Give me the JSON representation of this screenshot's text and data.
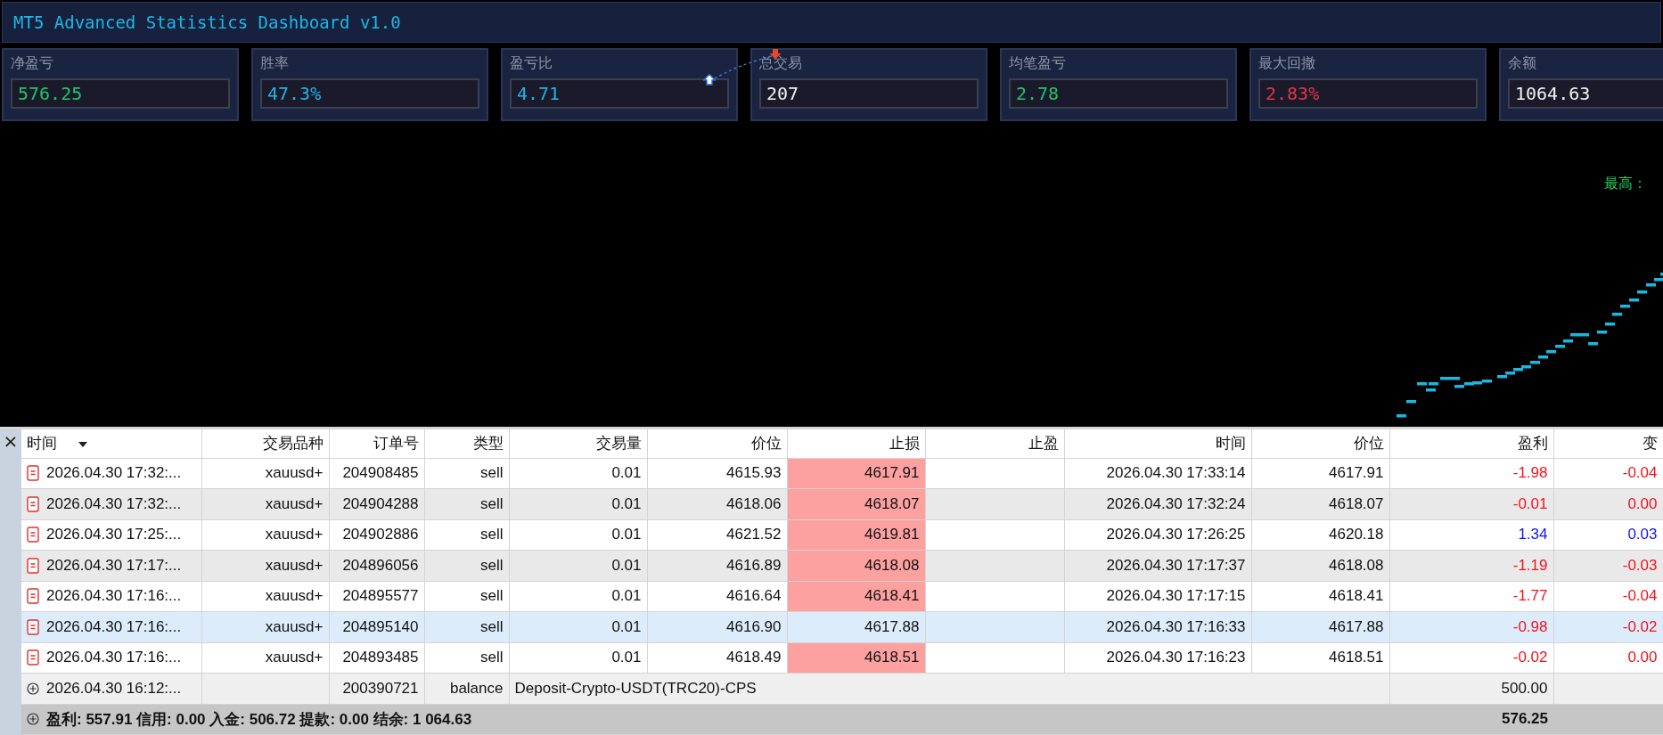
{
  "window": {
    "title": "MT5 Advanced Statistics Dashboard v1.0"
  },
  "cards": [
    {
      "label": "净盈亏",
      "value": "576.25",
      "color": "#1fc46c"
    },
    {
      "label": "胜率",
      "value": "47.3%",
      "color": "#1eb6e6"
    },
    {
      "label": "盈亏比",
      "value": "4.71",
      "color": "#1eb6e6"
    },
    {
      "label": "总交易",
      "value": "207",
      "color": "#f2f2f2"
    },
    {
      "label": "均笔盈亏",
      "value": "2.78",
      "color": "#1fc46c"
    },
    {
      "label": "最大回撤",
      "value": "2.83%",
      "color": "#e0354a"
    },
    {
      "label": "余额",
      "value": "1064.63",
      "color": "#f2f2f2"
    }
  ],
  "chart": {
    "high_label": "最高："
  },
  "side_panel": {
    "close": "×"
  },
  "table": {
    "columns": [
      {
        "label": "时间",
        "sorted": true
      },
      {
        "label": "交易品种",
        "sorted": false
      },
      {
        "label": "订单号",
        "sorted": false
      },
      {
        "label": "类型",
        "sorted": false
      },
      {
        "label": "交易量",
        "sorted": false
      },
      {
        "label": "价位",
        "sorted": false
      },
      {
        "label": "止损",
        "sorted": false
      },
      {
        "label": "止盈",
        "sorted": false
      },
      {
        "label": "时间",
        "sorted": false
      },
      {
        "label": "价位",
        "sorted": false
      },
      {
        "label": "盈利",
        "sorted": false
      },
      {
        "label": "变",
        "sorted": false
      }
    ],
    "rows": [
      {
        "kind": "trade",
        "selected": false,
        "sl_highlight": true,
        "loss": true,
        "cells": [
          "2026.04.30 17:32:...",
          "xauusd+",
          "204908485",
          "sell",
          "0.01",
          "4615.93",
          "4617.91",
          "",
          "2026.04.30 17:33:14",
          "4617.91",
          "-1.98",
          "-0.04"
        ]
      },
      {
        "kind": "trade",
        "selected": false,
        "sl_highlight": true,
        "loss": true,
        "cells": [
          "2026.04.30 17:32:...",
          "xauusd+",
          "204904288",
          "sell",
          "0.01",
          "4618.06",
          "4618.07",
          "",
          "2026.04.30 17:32:24",
          "4618.07",
          "-0.01",
          "0.00"
        ]
      },
      {
        "kind": "trade",
        "selected": false,
        "sl_highlight": true,
        "loss": false,
        "cells": [
          "2026.04.30 17:25:...",
          "xauusd+",
          "204902886",
          "sell",
          "0.01",
          "4621.52",
          "4619.81",
          "",
          "2026.04.30 17:26:25",
          "4620.18",
          "1.34",
          "0.03"
        ]
      },
      {
        "kind": "trade",
        "selected": false,
        "sl_highlight": true,
        "loss": true,
        "cells": [
          "2026.04.30 17:17:...",
          "xauusd+",
          "204896056",
          "sell",
          "0.01",
          "4616.89",
          "4618.08",
          "",
          "2026.04.30 17:17:37",
          "4618.08",
          "-1.19",
          "-0.03"
        ]
      },
      {
        "kind": "trade",
        "selected": false,
        "sl_highlight": true,
        "loss": true,
        "cells": [
          "2026.04.30 17:16:...",
          "xauusd+",
          "204895577",
          "sell",
          "0.01",
          "4616.64",
          "4618.41",
          "",
          "2026.04.30 17:17:15",
          "4618.41",
          "-1.77",
          "-0.04"
        ]
      },
      {
        "kind": "trade",
        "selected": true,
        "sl_highlight": false,
        "loss": true,
        "cells": [
          "2026.04.30 17:16:...",
          "xauusd+",
          "204895140",
          "sell",
          "0.01",
          "4616.90",
          "4617.88",
          "",
          "2026.04.30 17:16:33",
          "4617.88",
          "-0.98",
          "-0.02"
        ]
      },
      {
        "kind": "trade",
        "selected": false,
        "sl_highlight": true,
        "loss": true,
        "cells": [
          "2026.04.30 17:16:...",
          "xauusd+",
          "204893485",
          "sell",
          "0.01",
          "4618.49",
          "4618.51",
          "",
          "2026.04.30 17:16:23",
          "4618.51",
          "-0.02",
          "0.00"
        ]
      },
      {
        "kind": "balance",
        "selected": false,
        "time": "2026.04.30 16:12:...",
        "order": "200390721",
        "type": "balance",
        "comment": "Deposit-Crypto-USDT(TRC20)-CPS",
        "profit": "500.00"
      }
    ],
    "summary": {
      "text": "盈利: 557.91  信用: 0.00  入金: 506.72  提款: 0.00  结余: 1 064.63",
      "profit": "576.25"
    }
  }
}
